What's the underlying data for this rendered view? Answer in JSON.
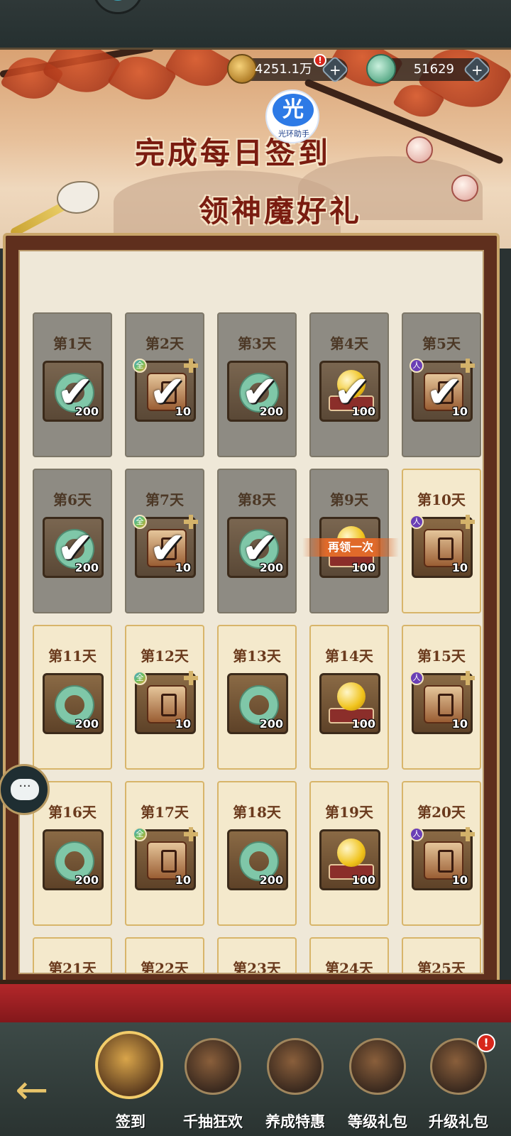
{
  "header": {
    "title_line1": "完成每日签到",
    "title_line2": "领神魔好礼",
    "helper_badge_char": "光",
    "helper_badge_name": "光环助手"
  },
  "currency": {
    "coins": {
      "value": "4251.1万",
      "icon": "coin-string-icon",
      "alert": "!"
    },
    "jade": {
      "value": "51629",
      "icon": "jade-icon"
    }
  },
  "days": [
    {
      "label": "第1天",
      "item": "jade",
      "qty": "200",
      "done": true
    },
    {
      "label": "第2天",
      "item": "chest",
      "qty": "10",
      "done": true,
      "tag": "全"
    },
    {
      "label": "第3天",
      "item": "jade",
      "qty": "200",
      "done": true
    },
    {
      "label": "第4天",
      "item": "orb",
      "qty": "100",
      "done": true
    },
    {
      "label": "第5天",
      "item": "chest",
      "qty": "10",
      "done": true,
      "tag": "人"
    },
    {
      "label": "第6天",
      "item": "jade",
      "qty": "200",
      "done": true
    },
    {
      "label": "第7天",
      "item": "chest",
      "qty": "10",
      "done": true,
      "tag": "全"
    },
    {
      "label": "第8天",
      "item": "jade",
      "qty": "200",
      "done": true
    },
    {
      "label": "第9天",
      "item": "orb",
      "qty": "100",
      "done": true,
      "again": "再领一次"
    },
    {
      "label": "第10天",
      "item": "chest",
      "qty": "10",
      "done": false,
      "tag": "人"
    },
    {
      "label": "第11天",
      "item": "jade",
      "qty": "200",
      "done": false
    },
    {
      "label": "第12天",
      "item": "chest",
      "qty": "10",
      "done": false,
      "tag": "全"
    },
    {
      "label": "第13天",
      "item": "jade",
      "qty": "200",
      "done": false
    },
    {
      "label": "第14天",
      "item": "orb",
      "qty": "100",
      "done": false
    },
    {
      "label": "第15天",
      "item": "chest",
      "qty": "10",
      "done": false,
      "tag": "人"
    },
    {
      "label": "第16天",
      "item": "jade",
      "qty": "200",
      "done": false
    },
    {
      "label": "第17天",
      "item": "chest",
      "qty": "10",
      "done": false,
      "tag": "全"
    },
    {
      "label": "第18天",
      "item": "jade",
      "qty": "200",
      "done": false
    },
    {
      "label": "第19天",
      "item": "orb",
      "qty": "100",
      "done": false
    },
    {
      "label": "第20天",
      "item": "chest",
      "qty": "10",
      "done": false,
      "tag": "人"
    },
    {
      "label": "第21天"
    },
    {
      "label": "第22天"
    },
    {
      "label": "第23天"
    },
    {
      "label": "第24天"
    },
    {
      "label": "第25天"
    }
  ],
  "tabs": [
    {
      "label": "签到",
      "icon": "sign-in-icon",
      "active": true
    },
    {
      "label": "千抽狂欢",
      "icon": "scroll-chest-icon"
    },
    {
      "label": "养成特惠",
      "icon": "treasure-box-icon"
    },
    {
      "label": "等级礼包",
      "icon": "gift-pot-icon"
    },
    {
      "label": "升级礼包",
      "icon": "gold-cauldron-icon",
      "alert": "!"
    }
  ],
  "colors": {
    "accent_gold": "#f2cc6a",
    "claimed_gray": "#8e8b83",
    "again_orange": "#e06a2a"
  }
}
